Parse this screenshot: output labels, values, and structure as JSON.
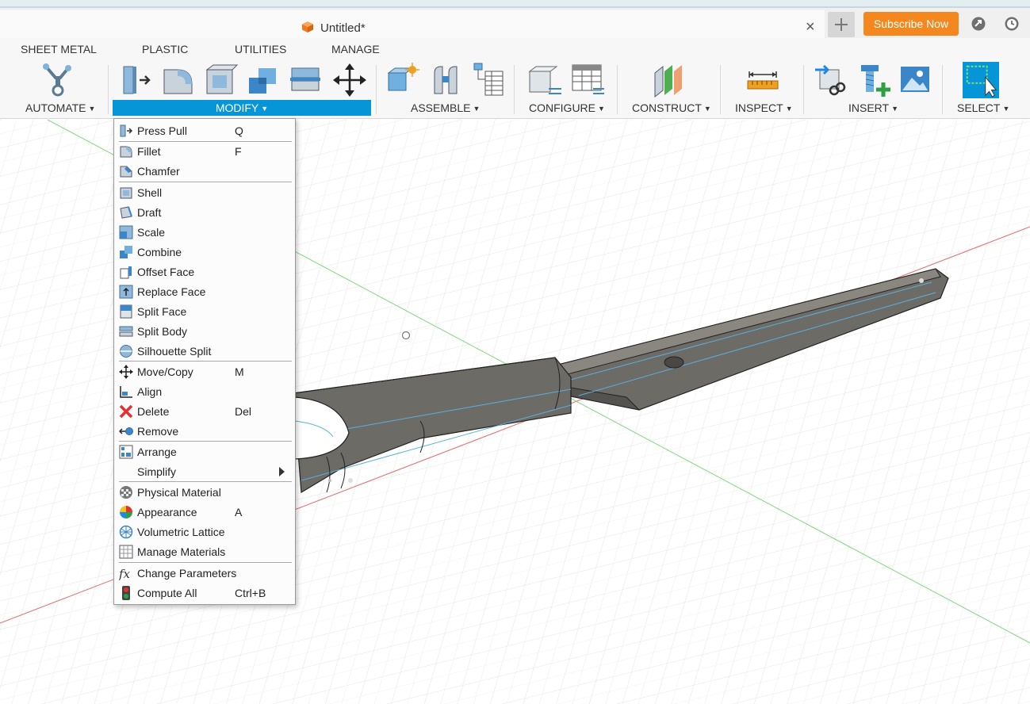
{
  "document": {
    "title": "Untitled*"
  },
  "header": {
    "subscribe_label": "Subscribe Now"
  },
  "toolbar": {
    "tabs": [
      "SHEET METAL",
      "PLASTIC",
      "UTILITIES",
      "MANAGE"
    ],
    "groups": {
      "automate": "AUTOMATE",
      "modify": "MODIFY",
      "assemble": "ASSEMBLE",
      "configure": "CONFIGURE",
      "construct": "CONSTRUCT",
      "inspect": "INSPECT",
      "insert": "INSERT",
      "select": "SELECT"
    }
  },
  "menu": {
    "items": [
      {
        "label": "Press Pull",
        "shortcut": "Q"
      },
      {
        "label": "Fillet",
        "shortcut": "F"
      },
      {
        "label": "Chamfer",
        "shortcut": ""
      },
      {
        "label": "Shell",
        "shortcut": ""
      },
      {
        "label": "Draft",
        "shortcut": ""
      },
      {
        "label": "Scale",
        "shortcut": ""
      },
      {
        "label": "Combine",
        "shortcut": ""
      },
      {
        "label": "Offset Face",
        "shortcut": ""
      },
      {
        "label": "Replace Face",
        "shortcut": ""
      },
      {
        "label": "Split Face",
        "shortcut": ""
      },
      {
        "label": "Split Body",
        "shortcut": ""
      },
      {
        "label": "Silhouette Split",
        "shortcut": ""
      },
      {
        "label": "Move/Copy",
        "shortcut": "M"
      },
      {
        "label": "Align",
        "shortcut": ""
      },
      {
        "label": "Delete",
        "shortcut": "Del"
      },
      {
        "label": "Remove",
        "shortcut": ""
      },
      {
        "label": "Arrange",
        "shortcut": ""
      },
      {
        "label": "Simplify",
        "shortcut": ""
      },
      {
        "label": "Physical Material",
        "shortcut": ""
      },
      {
        "label": "Appearance",
        "shortcut": "A"
      },
      {
        "label": "Volumetric Lattice",
        "shortcut": ""
      },
      {
        "label": "Manage Materials",
        "shortcut": ""
      },
      {
        "label": "Change Parameters",
        "shortcut": ""
      },
      {
        "label": "Compute All",
        "shortcut": "Ctrl+B"
      }
    ]
  },
  "colors": {
    "accent": "#0696d7",
    "subscribe": "#f5871f",
    "delete": "#e53030"
  }
}
